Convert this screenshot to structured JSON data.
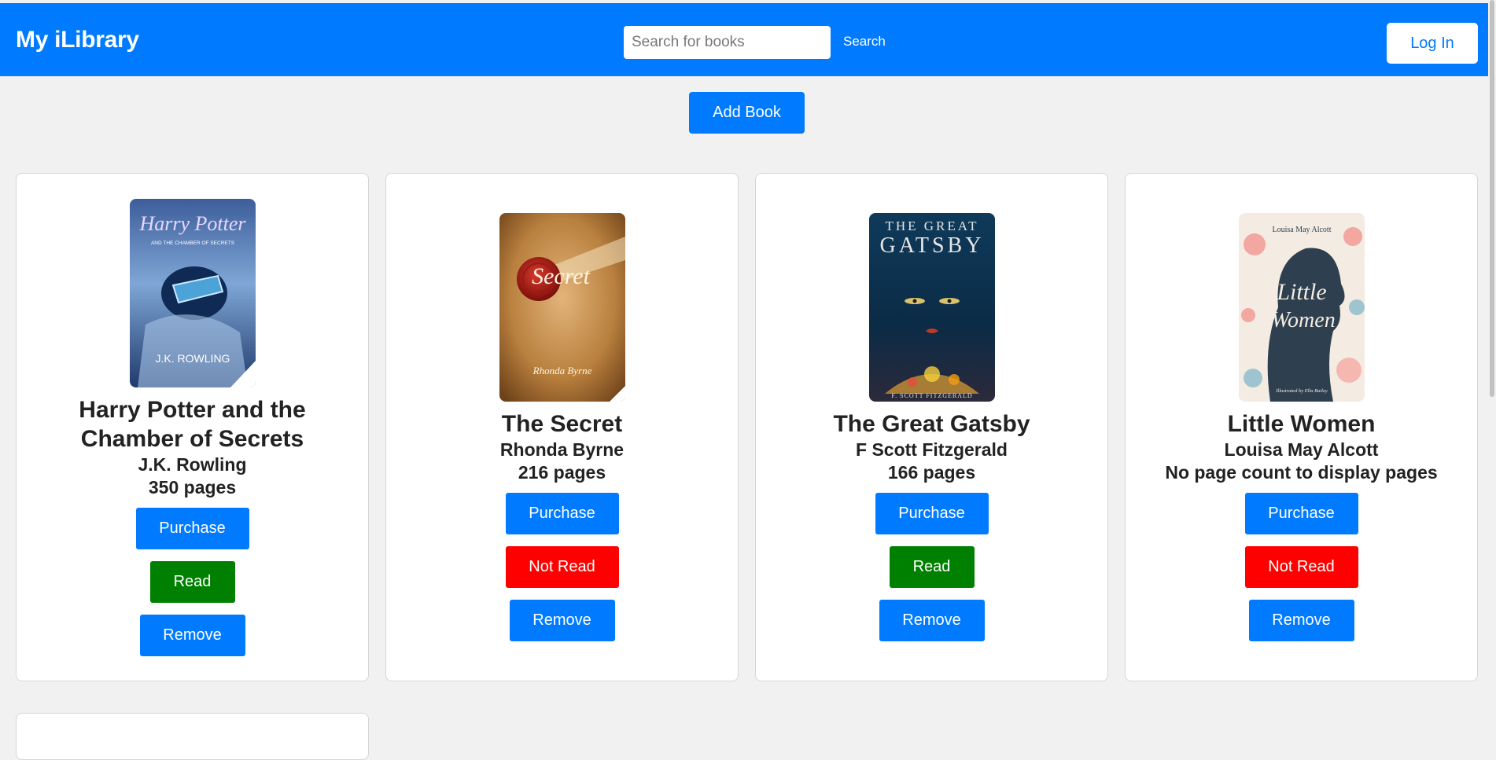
{
  "header": {
    "brand": "My iLibrary",
    "search_placeholder": "Search for books",
    "search_label": "Search",
    "login_label": "Log In"
  },
  "add_book_label": "Add Book",
  "books": [
    {
      "cover_text": [
        "Harry Potter",
        "AND THE CHAMBER OF SECRETS",
        "J.K. ROWLING"
      ],
      "title": "Harry Potter and the Chamber of Secrets",
      "author": "J.K. Rowling",
      "pages": "350 pages",
      "purchase_label": "Purchase",
      "read_label": "Read",
      "read_status": "read",
      "remove_label": "Remove"
    },
    {
      "cover_text": [
        "Secret",
        "Rhonda Byrne"
      ],
      "title": "The Secret",
      "author": "Rhonda Byrne",
      "pages": "216 pages",
      "purchase_label": "Purchase",
      "read_label": "Not Read",
      "read_status": "not-read",
      "remove_label": "Remove"
    },
    {
      "cover_text": [
        "THE GREAT",
        "GATSBY",
        "F. SCOTT FITZGERALD"
      ],
      "title": "The Great Gatsby",
      "author": "F Scott Fitzgerald",
      "pages": "166 pages",
      "purchase_label": "Purchase",
      "read_label": "Read",
      "read_status": "read",
      "remove_label": "Remove"
    },
    {
      "cover_text": [
        "Louisa May Alcott",
        "Little",
        "Women",
        "Illustrated by Ella Bailey"
      ],
      "title": "Little Women",
      "author": "Louisa May Alcott",
      "pages": "No page count to display pages",
      "purchase_label": "Purchase",
      "read_label": "Not Read",
      "read_status": "not-read",
      "remove_label": "Remove"
    }
  ],
  "colors": {
    "primary": "#007bff",
    "read": "#008000",
    "not_read": "#ff0000",
    "background": "#f1f1f1"
  }
}
